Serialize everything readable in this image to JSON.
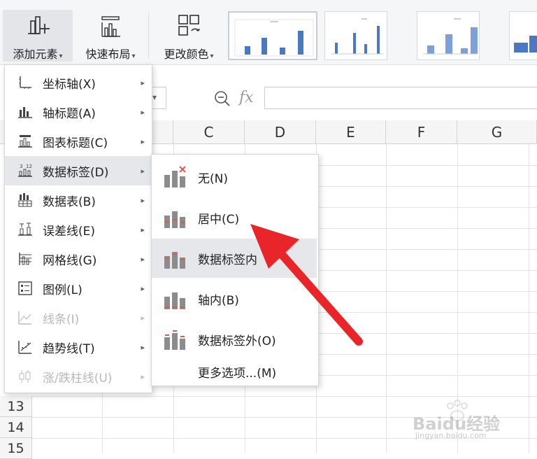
{
  "ribbon": {
    "add_element": "添加元素",
    "quick_layout": "快速布局",
    "change_color": "更改颜色"
  },
  "columns": [
    "C",
    "D",
    "E",
    "F",
    "G"
  ],
  "rows": [
    "13",
    "14",
    "15"
  ],
  "menu": {
    "items": [
      {
        "label": "坐标轴(X)",
        "enabled": true
      },
      {
        "label": "轴标题(A)",
        "enabled": true
      },
      {
        "label": "图表标题(C)",
        "enabled": true
      },
      {
        "label": "数据标签(D)",
        "enabled": true,
        "highlighted": true
      },
      {
        "label": "数据表(B)",
        "enabled": true
      },
      {
        "label": "误差线(E)",
        "enabled": true
      },
      {
        "label": "网格线(G)",
        "enabled": true
      },
      {
        "label": "图例(L)",
        "enabled": true
      },
      {
        "label": "线条(I)",
        "enabled": false
      },
      {
        "label": "趋势线(T)",
        "enabled": true
      },
      {
        "label": "涨/跌柱线(U)",
        "enabled": false
      }
    ]
  },
  "submenu": {
    "items": [
      {
        "label": "无(N)"
      },
      {
        "label": "居中(C)"
      },
      {
        "label": "数据标签内",
        "highlighted": true
      },
      {
        "label": "轴内(B)"
      },
      {
        "label": "数据标签外(O)"
      }
    ],
    "more": "更多选项...(M)"
  },
  "watermark": {
    "brand": "Baidu经验",
    "url": "jingyan.baidu.com"
  },
  "colors": {
    "accent_bar": "#4a78c2",
    "arrow": "#e8262a",
    "label_red": "#e05a4c",
    "bar_gray": "#8c8c8c"
  }
}
